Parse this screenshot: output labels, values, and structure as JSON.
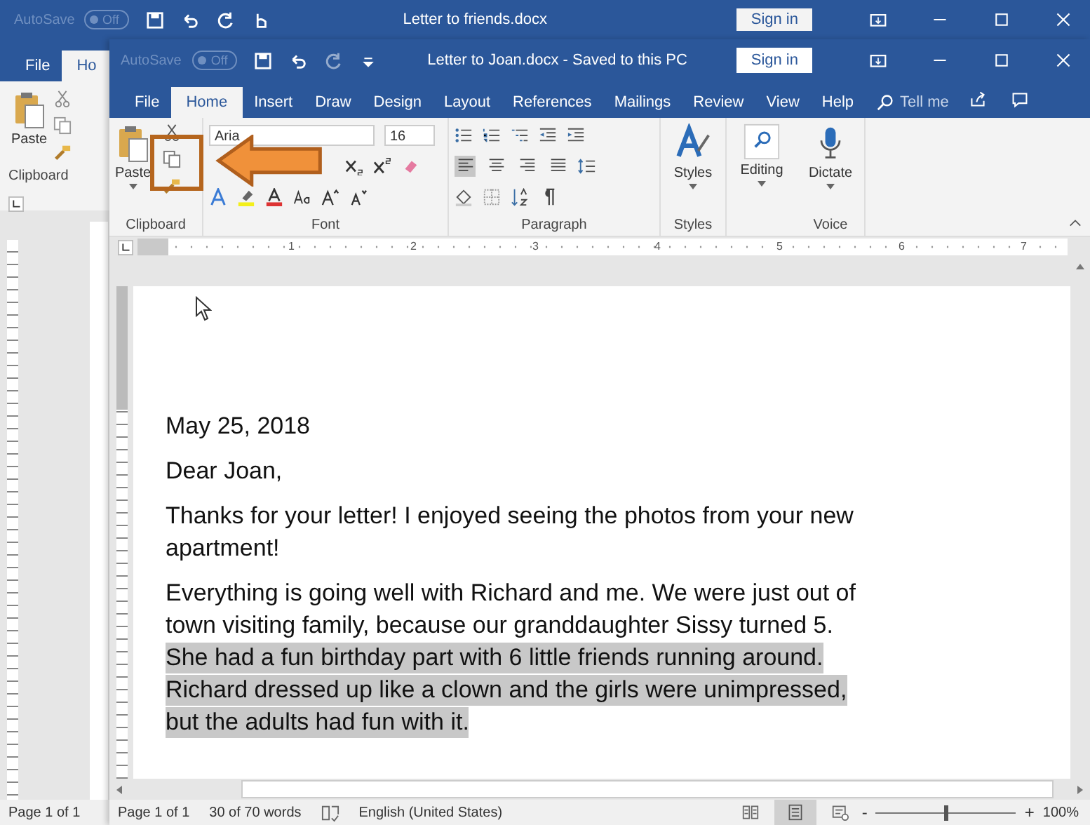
{
  "back_window": {
    "autosave": "AutoSave",
    "toggle": "Off",
    "title": "Letter to friends.docx",
    "sign_in": "Sign in",
    "tabs": [
      {
        "label": "File",
        "selected": false
      },
      {
        "label": "Ho",
        "selected": true
      }
    ],
    "paste": "Paste",
    "clipboard": "Clipboard",
    "status_page": "Page 1 of 1"
  },
  "front_window": {
    "autosave": "AutoSave",
    "toggle": "Off",
    "title": "Letter to Joan.docx  -  Saved to this PC",
    "sign_in": "Sign in",
    "tabs": [
      {
        "label": "File",
        "selected": false
      },
      {
        "label": "Home",
        "selected": true
      },
      {
        "label": "Insert",
        "selected": false
      },
      {
        "label": "Draw",
        "selected": false
      },
      {
        "label": "Design",
        "selected": false
      },
      {
        "label": "Layout",
        "selected": false
      },
      {
        "label": "References",
        "selected": false
      },
      {
        "label": "Mailings",
        "selected": false
      },
      {
        "label": "Review",
        "selected": false
      },
      {
        "label": "View",
        "selected": false
      },
      {
        "label": "Help",
        "selected": false
      }
    ],
    "tell_me": "Tell me",
    "ribbon": {
      "paste": "Paste",
      "font": "Aria",
      "size": "16",
      "styles": "Styles",
      "editing": "Editing",
      "dictate": "Dictate",
      "align": [
        {
          "selected": true
        },
        {
          "selected": false
        },
        {
          "selected": false
        },
        {
          "selected": false
        }
      ],
      "groups": [
        {
          "label": "Clipboard"
        },
        {
          "label": "Font"
        },
        {
          "label": "Paragraph"
        },
        {
          "label": "Styles"
        },
        {
          "label": "Voice"
        }
      ]
    },
    "ruler": [
      "1",
      "2",
      "3",
      "4",
      "5",
      "6",
      "7"
    ],
    "paragraphs": [
      {
        "lines": [
          {
            "text": "May 25, 2018",
            "selected": false
          }
        ]
      },
      {
        "lines": [
          {
            "text": "Dear Joan,",
            "selected": false
          }
        ]
      },
      {
        "lines": [
          {
            "text": "Thanks for your letter! I enjoyed seeing the photos from your new",
            "selected": false
          },
          {
            "text": "apartment!",
            "selected": false
          }
        ]
      },
      {
        "lines": [
          {
            "text": "Everything is going well with Richard and me. We were just out of",
            "selected": false
          },
          {
            "text": "town visiting family, because our granddaughter Sissy turned 5.",
            "selected": false
          },
          {
            "text": "She had a fun birthday part with 6 little friends running around.",
            "selected": true
          },
          {
            "text": "Richard dressed up like a clown and the girls were unimpressed,",
            "selected": true
          },
          {
            "text": "but the adults had fun with it.",
            "selected": true
          }
        ]
      }
    ],
    "status_bar": {
      "page": "Page 1 of 1",
      "words": "30 of 70 words",
      "language": "English (United States)",
      "views": [
        {
          "kind": "read",
          "selected": false
        },
        {
          "kind": "print",
          "selected": true
        },
        {
          "kind": "web",
          "selected": false
        }
      ],
      "zoom_out": "-",
      "zoom_in": "+",
      "level": 0.5,
      "zoom": "100%"
    }
  }
}
